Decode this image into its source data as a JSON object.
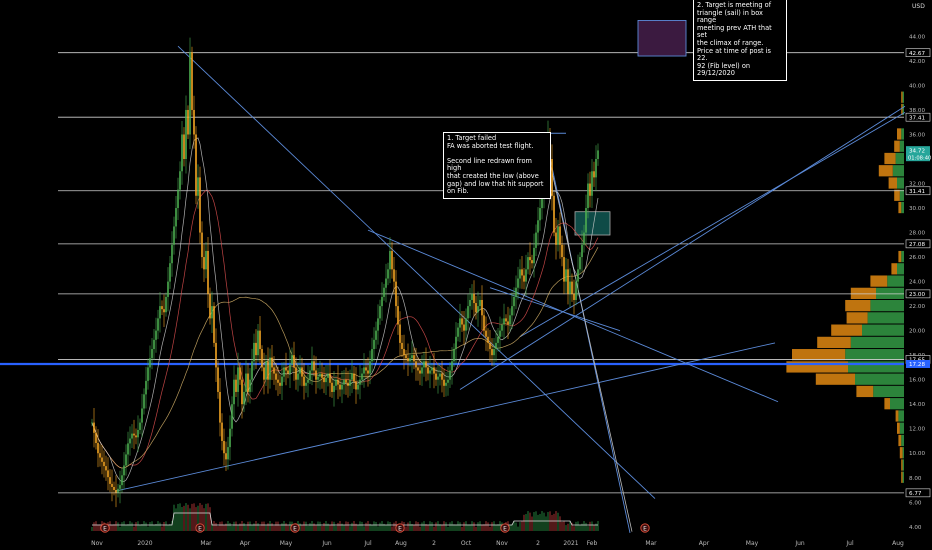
{
  "chart_data": {
    "type": "candlestick",
    "currency": "USD",
    "x_tick_labels": [
      "Nov",
      "2020",
      "Mar",
      "Apr",
      "May",
      "Jun",
      "Jul",
      "Aug",
      "2",
      "Oct",
      "Nov",
      "2",
      "2021",
      "Feb",
      "Mar",
      "Apr",
      "May",
      "Jun",
      "Jul",
      "Aug"
    ],
    "y_tick_labels": [
      "44.00",
      "42.00",
      "40.00",
      "38.00",
      "36.00",
      "34.00",
      "32.00",
      "30.00",
      "28.00",
      "26.00",
      "24.00",
      "22.00",
      "20.00",
      "18.00",
      "16.00",
      "14.00",
      "12.00",
      "10.00",
      "8.00",
      "6.00",
      "4.00"
    ],
    "ylim": [
      3.5,
      46
    ],
    "horizontal_levels": [
      {
        "value": 42.67,
        "label": "42.67"
      },
      {
        "value": 37.41,
        "label": "37.41"
      },
      {
        "value": 31.41,
        "label": "31.41"
      },
      {
        "value": 27.08,
        "label": "27.08"
      },
      {
        "value": 23.0,
        "label": "23.00"
      },
      {
        "value": 17.65,
        "label": "17.65"
      },
      {
        "value": 6.77,
        "label": "6.77"
      }
    ],
    "highlight_levels": [
      {
        "value": 17.28,
        "label": "17.28",
        "color": "#2962ff"
      },
      {
        "value": 34.72,
        "label": "34.72",
        "sublabel": "01:08:40",
        "color": "#26a69a"
      }
    ],
    "earnings_marker": "E",
    "price_path": [
      [
        0,
        12.5
      ],
      [
        3,
        10
      ],
      [
        5,
        9.3
      ],
      [
        7,
        8.6
      ],
      [
        9,
        7.5
      ],
      [
        11,
        7.0
      ],
      [
        12,
        6.8
      ],
      [
        14,
        7.4
      ],
      [
        16,
        9.0
      ],
      [
        18,
        10.8
      ],
      [
        20,
        11.6
      ],
      [
        22,
        11.3
      ],
      [
        24,
        12.5
      ],
      [
        26,
        14.8
      ],
      [
        28,
        17.0
      ],
      [
        30,
        18.5
      ],
      [
        32,
        20.0
      ],
      [
        34,
        22.0
      ],
      [
        36,
        21.5
      ],
      [
        38,
        24.0
      ],
      [
        40,
        27.0
      ],
      [
        42,
        30.0
      ],
      [
        44,
        33.0
      ],
      [
        45,
        36.0
      ],
      [
        46,
        34.0
      ],
      [
        47,
        38.0
      ],
      [
        48,
        36.0
      ],
      [
        49,
        42.7
      ],
      [
        50,
        38.0
      ],
      [
        51,
        36.0
      ],
      [
        52,
        31.0
      ],
      [
        53,
        32.5
      ],
      [
        54,
        28.0
      ],
      [
        55,
        26.0
      ],
      [
        56,
        25.0
      ],
      [
        57,
        26.5
      ],
      [
        58,
        23.0
      ],
      [
        59,
        21.0
      ],
      [
        60,
        22.0
      ],
      [
        61,
        19.0
      ],
      [
        62,
        17.0
      ],
      [
        63,
        15.0
      ],
      [
        64,
        12.5
      ],
      [
        65,
        11.0
      ],
      [
        66,
        10.0
      ],
      [
        67,
        9.5
      ],
      [
        68,
        10.5
      ],
      [
        69,
        12.0
      ],
      [
        70,
        14.0
      ],
      [
        71,
        16.0
      ],
      [
        72,
        15.0
      ],
      [
        73,
        17.0
      ],
      [
        74,
        16.0
      ],
      [
        75,
        14.0
      ],
      [
        76,
        15.0
      ],
      [
        77,
        16.5
      ],
      [
        78,
        15.0
      ],
      [
        79,
        16.0
      ],
      [
        80,
        17.5
      ],
      [
        81,
        19.0
      ],
      [
        82,
        18.0
      ],
      [
        83,
        20.0
      ],
      [
        84,
        18.5
      ],
      [
        85,
        17.0
      ],
      [
        86,
        16.0
      ],
      [
        87,
        17.5
      ],
      [
        88,
        16.0
      ],
      [
        89,
        17.8
      ],
      [
        90,
        17.0
      ],
      [
        92,
        16.0
      ],
      [
        94,
        15.5
      ],
      [
        96,
        17.0
      ],
      [
        98,
        16.5
      ],
      [
        100,
        18.0
      ],
      [
        102,
        16.0
      ],
      [
        104,
        17.0
      ],
      [
        106,
        15.5
      ],
      [
        108,
        16.0
      ],
      [
        110,
        17.5
      ],
      [
        112,
        16.0
      ],
      [
        114,
        16.5
      ],
      [
        116,
        15.8
      ],
      [
        118,
        16.5
      ],
      [
        120,
        15.0
      ],
      [
        122,
        16.0
      ],
      [
        124,
        15.2
      ],
      [
        126,
        16.0
      ],
      [
        128,
        15.5
      ],
      [
        130,
        16.5
      ],
      [
        132,
        15.2
      ],
      [
        134,
        16.0
      ],
      [
        136,
        17.0
      ],
      [
        138,
        16.5
      ],
      [
        140,
        18.5
      ],
      [
        142,
        20.0
      ],
      [
        144,
        22.0
      ],
      [
        146,
        23.5
      ],
      [
        148,
        25.0
      ],
      [
        149,
        26.5
      ],
      [
        150,
        25.0
      ],
      [
        151,
        24.0
      ],
      [
        152,
        22.0
      ],
      [
        153,
        20.5
      ],
      [
        154,
        19.0
      ],
      [
        156,
        18.0
      ],
      [
        158,
        17.5
      ],
      [
        160,
        18.0
      ],
      [
        162,
        17.0
      ],
      [
        164,
        16.5
      ],
      [
        166,
        17.5
      ],
      [
        168,
        16.5
      ],
      [
        170,
        17.0
      ],
      [
        172,
        16.0
      ],
      [
        174,
        16.5
      ],
      [
        176,
        15.5
      ],
      [
        178,
        16.0
      ],
      [
        180,
        17.5
      ],
      [
        182,
        19.5
      ],
      [
        184,
        21.0
      ],
      [
        186,
        20.0
      ],
      [
        188,
        22.0
      ],
      [
        190,
        23.0
      ],
      [
        192,
        21.5
      ],
      [
        194,
        22.5
      ],
      [
        196,
        20.0
      ],
      [
        198,
        19.0
      ],
      [
        200,
        18.0
      ],
      [
        202,
        19.0
      ],
      [
        204,
        20.0
      ],
      [
        206,
        21.0
      ],
      [
        208,
        20.5
      ],
      [
        210,
        22.0
      ],
      [
        212,
        23.5
      ],
      [
        214,
        25.0
      ],
      [
        216,
        24.0
      ],
      [
        218,
        26.0
      ],
      [
        220,
        25.5
      ],
      [
        222,
        28.0
      ],
      [
        224,
        30.0
      ],
      [
        226,
        32.0
      ],
      [
        227,
        35.0
      ],
      [
        228,
        36.0
      ],
      [
        229,
        34.0
      ],
      [
        230,
        31.0
      ],
      [
        231,
        28.0
      ],
      [
        232,
        27.0
      ],
      [
        233,
        28.5
      ],
      [
        234,
        27.0
      ],
      [
        235,
        26.0
      ],
      [
        236,
        24.0
      ],
      [
        237,
        25.0
      ],
      [
        238,
        23.0
      ],
      [
        239,
        24.0
      ],
      [
        240,
        23.0
      ],
      [
        241,
        22.5
      ],
      [
        242,
        24.0
      ],
      [
        243,
        25.0
      ],
      [
        244,
        26.0
      ],
      [
        245,
        27.0
      ],
      [
        246,
        28.0
      ],
      [
        247,
        30.0
      ],
      [
        248,
        32.0
      ],
      [
        249,
        31.0
      ],
      [
        250,
        33.0
      ],
      [
        251,
        32.5
      ],
      [
        252,
        34.0
      ],
      [
        253,
        34.7
      ]
    ],
    "volume_profile": {
      "type": "horizontal_histogram",
      "bins": [
        {
          "price": 26.0,
          "up": 2,
          "down": 2
        },
        {
          "price": 25.0,
          "up": 5,
          "down": 4
        },
        {
          "price": 24.0,
          "up": 12,
          "down": 12
        },
        {
          "price": 23.0,
          "up": 20,
          "down": 18
        },
        {
          "price": 22.0,
          "up": 24,
          "down": 18
        },
        {
          "price": 21.0,
          "up": 26,
          "down": 15
        },
        {
          "price": 20.0,
          "up": 30,
          "down": 22
        },
        {
          "price": 19.0,
          "up": 38,
          "down": 24
        },
        {
          "price": 18.0,
          "up": 42,
          "down": 38
        },
        {
          "price": 17.0,
          "up": 40,
          "down": 44
        },
        {
          "price": 16.0,
          "up": 35,
          "down": 28
        },
        {
          "price": 15.0,
          "up": 22,
          "down": 12
        },
        {
          "price": 14.0,
          "up": 10,
          "down": 4
        },
        {
          "price": 13.0,
          "up": 4,
          "down": 2
        },
        {
          "price": 12.0,
          "up": 3,
          "down": 2
        },
        {
          "price": 11.0,
          "up": 2,
          "down": 2
        },
        {
          "price": 10.0,
          "up": 1,
          "down": 2
        },
        {
          "price": 9.0,
          "up": 1,
          "down": 1
        },
        {
          "price": 8.0,
          "up": 1,
          "down": 1
        },
        {
          "price": 36.0,
          "up": 2,
          "down": 3
        },
        {
          "price": 35.0,
          "up": 3,
          "down": 4
        },
        {
          "price": 34.0,
          "up": 6,
          "down": 8
        },
        {
          "price": 33.0,
          "up": 8,
          "down": 10
        },
        {
          "price": 32.0,
          "up": 5,
          "down": 6
        },
        {
          "price": 31.0,
          "up": 3,
          "down": 4
        },
        {
          "price": 30.0,
          "up": 2,
          "down": 2
        },
        {
          "price": 39.0,
          "up": 1,
          "down": 1
        },
        {
          "price": 38.0,
          "up": 1,
          "down": 1
        }
      ]
    }
  },
  "annotations": {
    "note1": "1. Target failed\nFA was aborted test flight.\n\nSecond line redrawn from high\nthat created the low (above\ngap) and low that hit support\non Fib.",
    "note2": "2. Target is meeting of\ntriangle (sail) in box range\nmeeting prev ATH that set\nthe climax of range.\nPrice at time of post is 22.\n92 (Fib level) on 29/12/2020"
  },
  "colors": {
    "up": "#26a69a",
    "down": "#ef5350",
    "candle_up": "#4caf50",
    "candle_down": "#f5a623",
    "trendline": "#5b8ad8",
    "level_line": "#d0d0d0",
    "volume_profile_up": "#2e8b3e",
    "volume_profile_down": "#c97a10",
    "target_box": "#3b1a40",
    "teal_box": "#0f4b47"
  }
}
